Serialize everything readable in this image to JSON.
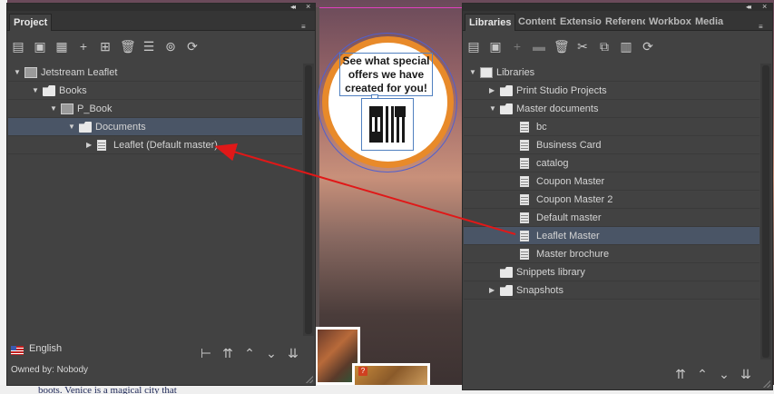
{
  "canvas": {
    "ad_text": "See what special offers we have created for you!",
    "body_text": "boots. Venice is a magical city that",
    "photo_badge": "?"
  },
  "project_panel": {
    "tab_label": "Project",
    "collapse_glyph": "◂◂",
    "close_glyph": "×",
    "menu_glyph": "≡",
    "toolbar": [
      {
        "name": "open-icon",
        "glyph": "▤"
      },
      {
        "name": "save-icon",
        "glyph": "▣"
      },
      {
        "name": "save-as-icon",
        "glyph": "▦"
      },
      {
        "name": "add-icon",
        "glyph": "+"
      },
      {
        "name": "add-folder-icon",
        "glyph": "⊞"
      },
      {
        "name": "delete-icon",
        "glyph": "🗑"
      },
      {
        "name": "properties-icon",
        "glyph": "☰"
      },
      {
        "name": "check-icon",
        "glyph": "⊚"
      },
      {
        "name": "refresh-icon",
        "glyph": "⟳"
      }
    ],
    "tree": [
      {
        "label": "Jetstream Leaflet",
        "indent": 0,
        "twisty": "▼",
        "icon": "book"
      },
      {
        "label": "Books",
        "indent": 1,
        "twisty": "▼",
        "icon": "folder"
      },
      {
        "label": "P_Book",
        "indent": 2,
        "twisty": "▼",
        "icon": "book"
      },
      {
        "label": "Documents",
        "indent": 3,
        "twisty": "▼",
        "icon": "folder",
        "selected": true
      },
      {
        "label": "Leaflet (Default master)",
        "indent": 4,
        "twisty": "▶",
        "icon": "doc"
      }
    ],
    "language": "English",
    "owned_by": "Owned by: Nobody",
    "footer_buttons": [
      {
        "name": "structure-icon",
        "glyph": "⊢"
      },
      {
        "name": "move-top-icon",
        "glyph": "⇈"
      },
      {
        "name": "move-up-icon",
        "glyph": "⌃"
      },
      {
        "name": "move-down-icon",
        "glyph": "⌄"
      },
      {
        "name": "move-bottom-icon",
        "glyph": "⇊"
      }
    ]
  },
  "libraries_panel": {
    "tabs": [
      "Libraries",
      "Content",
      "Extension",
      "Reference",
      "Workbox",
      "Media"
    ],
    "active_tab": "Libraries",
    "collapse_glyph": "◂◂",
    "close_glyph": "×",
    "menu_glyph": "≡",
    "toolbar": [
      {
        "name": "open-icon",
        "glyph": "▤",
        "dim": false
      },
      {
        "name": "save-icon",
        "glyph": "▣",
        "dim": false
      },
      {
        "name": "add-icon",
        "glyph": "+",
        "dim": true
      },
      {
        "name": "new-folder-icon",
        "glyph": "▬",
        "dim": true
      },
      {
        "name": "delete-icon",
        "glyph": "🗑",
        "dim": false
      },
      {
        "name": "cut-icon",
        "glyph": "✂",
        "dim": false
      },
      {
        "name": "copy-icon",
        "glyph": "⧉",
        "dim": false
      },
      {
        "name": "paste-icon",
        "glyph": "▥",
        "dim": false
      },
      {
        "name": "refresh-icon",
        "glyph": "⟳",
        "dim": false
      }
    ],
    "tree": [
      {
        "label": "Libraries",
        "indent": 0,
        "twisty": "▼",
        "icon": "lib"
      },
      {
        "label": "Print Studio Projects",
        "indent": 1,
        "twisty": "▶",
        "icon": "folder"
      },
      {
        "label": "Master documents",
        "indent": 1,
        "twisty": "▼",
        "icon": "folder"
      },
      {
        "label": "bc",
        "indent": 2,
        "twisty": "",
        "icon": "doc"
      },
      {
        "label": "Business Card",
        "indent": 2,
        "twisty": "",
        "icon": "doc"
      },
      {
        "label": "catalog",
        "indent": 2,
        "twisty": "",
        "icon": "doc"
      },
      {
        "label": "Coupon Master",
        "indent": 2,
        "twisty": "",
        "icon": "doc"
      },
      {
        "label": "Coupon Master 2",
        "indent": 2,
        "twisty": "",
        "icon": "doc"
      },
      {
        "label": "Default master",
        "indent": 2,
        "twisty": "",
        "icon": "doc"
      },
      {
        "label": "Leaflet Master",
        "indent": 2,
        "twisty": "",
        "icon": "doc",
        "selected": true
      },
      {
        "label": "Master brochure",
        "indent": 2,
        "twisty": "",
        "icon": "doc"
      },
      {
        "label": "Snippets library",
        "indent": 1,
        "twisty": "",
        "icon": "folder"
      },
      {
        "label": "Snapshots",
        "indent": 1,
        "twisty": "▶",
        "icon": "folder"
      }
    ],
    "footer_buttons": [
      {
        "name": "move-top-icon",
        "glyph": "⇈"
      },
      {
        "name": "move-up-icon",
        "glyph": "⌃"
      },
      {
        "name": "move-down-icon",
        "glyph": "⌄"
      },
      {
        "name": "move-bottom-icon",
        "glyph": "⇊"
      }
    ]
  },
  "colors": {
    "annotation_arrow": "#e01818",
    "selection": "#4a5566",
    "panel_bg": "#424242",
    "ad_ring": "#e88a2a"
  }
}
